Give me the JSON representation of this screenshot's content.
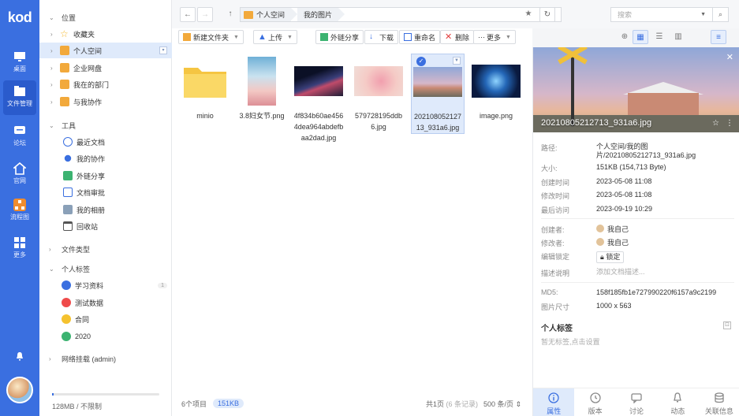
{
  "rail": {
    "logo": "kod",
    "items": [
      {
        "label": "桌面",
        "icon": "desktop-icon"
      },
      {
        "label": "文件管理",
        "icon": "folder-manage-icon"
      },
      {
        "label": "论坛",
        "icon": "forum-icon"
      },
      {
        "label": "官网",
        "icon": "home-icon"
      },
      {
        "label": "流程图",
        "icon": "flowchart-icon"
      },
      {
        "label": "更多",
        "icon": "grid-icon"
      }
    ]
  },
  "sidebar": {
    "location_title": "位置",
    "location_items": [
      "收藏夹",
      "个人空间",
      "企业网盘",
      "我在的部门",
      "与我协作"
    ],
    "tools_title": "工具",
    "tools_items": [
      "最近文档",
      "我的协作",
      "外链分享",
      "文档审批",
      "我的相册",
      "回收站"
    ],
    "filetype_title": "文件类型",
    "tags_title": "个人标签",
    "tags": [
      {
        "label": "学习资料",
        "color": "#3a6fe0",
        "count": "1"
      },
      {
        "label": "测试数据",
        "color": "#ef4b4b",
        "count": ""
      },
      {
        "label": "合同",
        "color": "#f5c22f",
        "count": ""
      },
      {
        "label": "2020",
        "color": "#3cb371",
        "count": ""
      }
    ],
    "mount_title": "网络挂载 (admin)",
    "storage": "128MB / 不限制"
  },
  "navbar": {
    "crumbs": [
      "个人空间",
      "我的图片"
    ],
    "search_placeholder": "搜索"
  },
  "toolbar": {
    "new_folder": "新建文件夹",
    "upload": "上传",
    "share": "外链分享",
    "download": "下载",
    "rename": "重命名",
    "delete": "删除",
    "more": "更多"
  },
  "files": [
    {
      "name": "minio",
      "type": "folder"
    },
    {
      "name": "3.8妇女节.png",
      "type": "image"
    },
    {
      "name": "4f834b60ae4564dea964abdefbaa2dad.jpg",
      "type": "image"
    },
    {
      "name": "579728195ddb6.jpg",
      "type": "image"
    },
    {
      "name": "20210805212713_931a6.jpg",
      "type": "image",
      "selected": true
    },
    {
      "name": "image.png",
      "type": "image"
    }
  ],
  "status": {
    "count": "6个项目",
    "size": "151KB",
    "page": "共1页",
    "records": "(6 条记录)",
    "per_page": "500 条/页"
  },
  "panel": {
    "title": "20210805212713_931a6.jpg",
    "path_label": "路径:",
    "path_value": "个人空间/我的图片/20210805212713_931a6.jpg",
    "size_label": "大小:",
    "size_value": "151KB (154,713 Byte)",
    "created_label": "创建时间",
    "created_value": "2023-05-08 11:08",
    "modified_label": "修改时间",
    "modified_value": "2023-05-08 11:08",
    "accessed_label": "最后访问",
    "accessed_value": "2023-09-19 10:29",
    "creator_label": "创建者:",
    "creator_value": "我自己",
    "modifier_label": "修改者:",
    "modifier_value": "我自己",
    "lock_label": "编辑锁定",
    "lock_value": "锁定",
    "desc_label": "描述说明",
    "desc_placeholder": "添加文档描述...",
    "md5_label": "MD5:",
    "md5_value": "158f185fb1e727990220f6157a9c2199",
    "dim_label": "图片尺寸",
    "dim_value": "1000 x 563",
    "tags_title": "个人标签",
    "tags_hint": "暂无标签,点击设置",
    "tabs": [
      "属性",
      "版本",
      "讨论",
      "动态",
      "关联信息"
    ]
  }
}
